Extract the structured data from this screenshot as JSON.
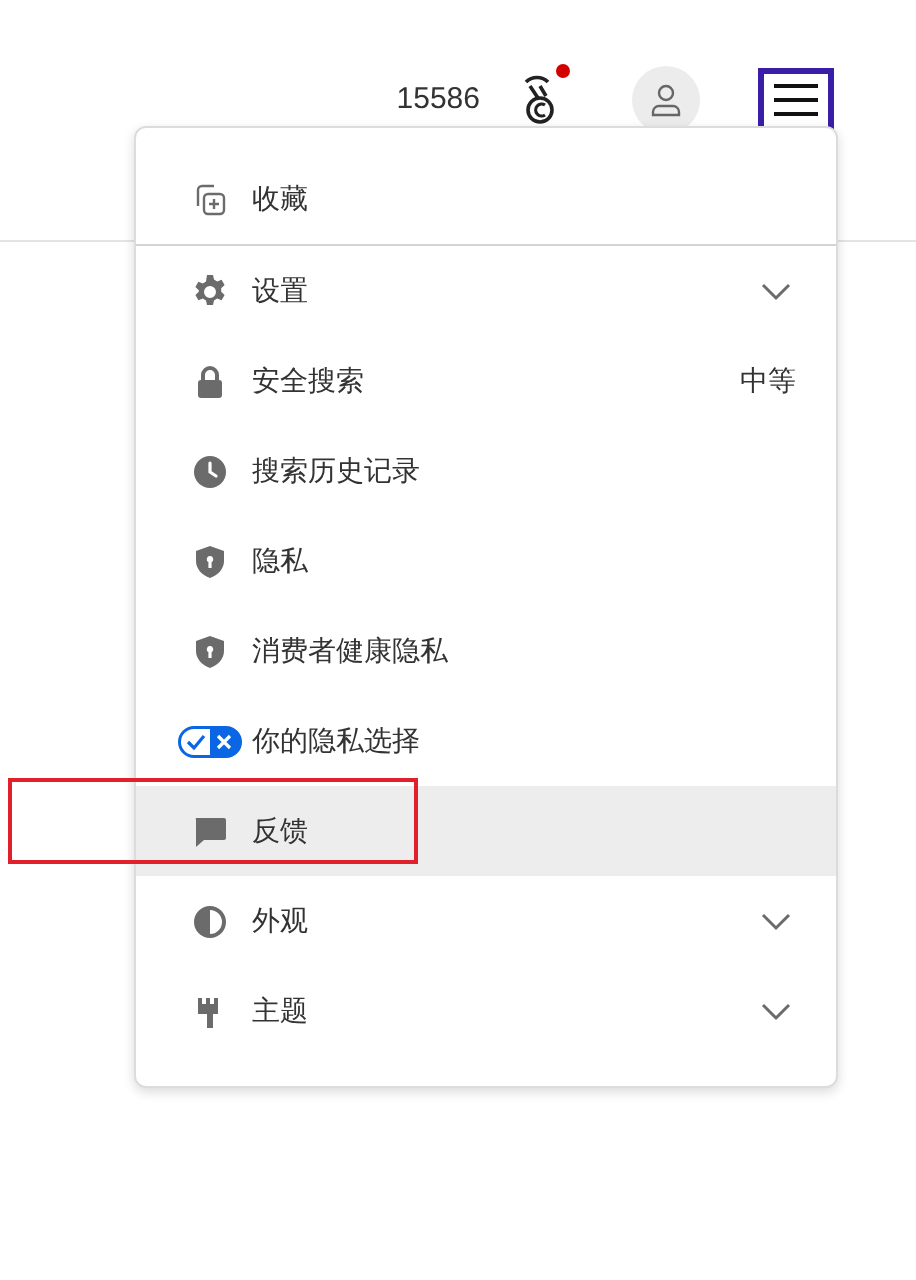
{
  "header": {
    "points": "15586",
    "notification": true
  },
  "menu": {
    "items": [
      {
        "label": "收藏",
        "kind": "plain",
        "selected": false
      },
      {
        "label": "设置",
        "kind": "expandable",
        "expanded": false,
        "selected": false
      },
      {
        "label": "安全搜索",
        "kind": "value",
        "value": "中等",
        "selected": false
      },
      {
        "label": "搜索历史记录",
        "kind": "plain",
        "selected": false
      },
      {
        "label": "隐私",
        "kind": "plain",
        "selected": false
      },
      {
        "label": "消费者健康隐私",
        "kind": "plain",
        "selected": false
      },
      {
        "label": "你的隐私选择",
        "kind": "plain",
        "selected": false
      },
      {
        "label": "反馈",
        "kind": "plain",
        "selected": true
      },
      {
        "label": "外观",
        "kind": "expandable",
        "expanded": false,
        "selected": false
      },
      {
        "label": "主题",
        "kind": "expandable",
        "expanded": false,
        "selected": false
      }
    ]
  }
}
